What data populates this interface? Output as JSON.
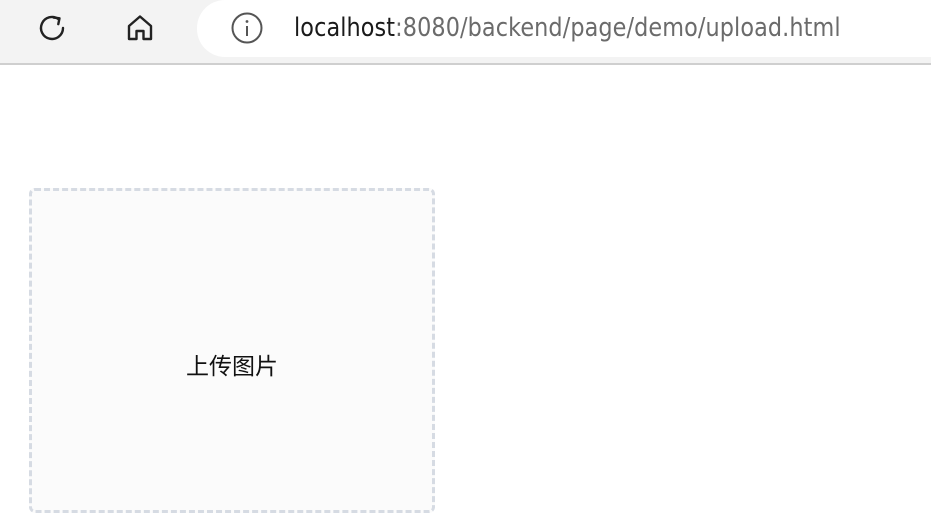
{
  "browser": {
    "url_host": "localhost",
    "url_path": ":8080/backend/page/demo/upload.html",
    "icons": [
      "refresh-icon",
      "home-icon",
      "info-icon"
    ]
  },
  "page": {
    "upload_label": "上传图片"
  },
  "colors": {
    "toolbar_bg": "#f3f3f3",
    "upload_border": "#d6dbe3",
    "upload_bg": "#fbfbfb"
  }
}
